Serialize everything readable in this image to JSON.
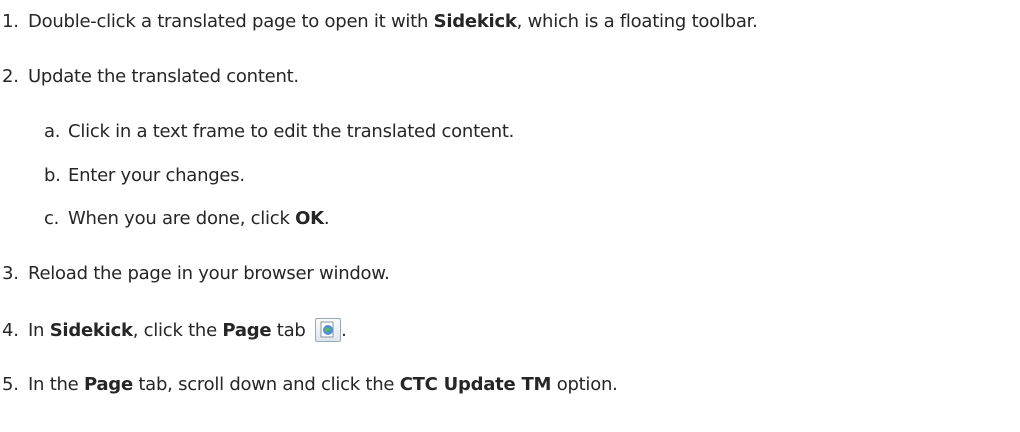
{
  "steps": [
    {
      "number": "1.",
      "text_before": "Double-click a translated page to open it with ",
      "bold": "Sidekick",
      "text_after": ", which is a floating toolbar."
    },
    {
      "number": "2.",
      "text": "Update the translated content.",
      "substeps": [
        {
          "letter": "a.",
          "text": "Click in a text frame to edit the translated content."
        },
        {
          "letter": "b.",
          "text": "Enter your changes."
        },
        {
          "letter": "c.",
          "text_before": "When you are done, click ",
          "bold": "OK",
          "text_after": "."
        }
      ]
    },
    {
      "number": "3.",
      "text": "Reload the page in your browser window."
    },
    {
      "number": "4.",
      "text_before": "In ",
      "bold1": "Sidekick",
      "text_middle": ", click the ",
      "bold2": "Page",
      "text_after": " tab",
      "icon": "page-tab-icon",
      "trailing": "."
    },
    {
      "number": "5.",
      "text_before": "In the ",
      "bold1": "Page",
      "text_middle": " tab, scroll down and click the ",
      "bold2": "CTC Update TM",
      "text_after": " option."
    }
  ]
}
